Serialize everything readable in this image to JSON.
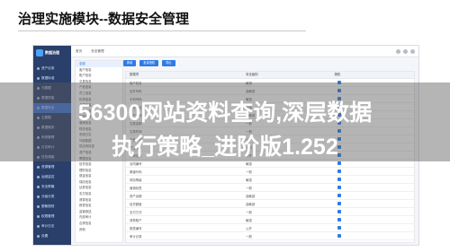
{
  "slide": {
    "title": "治理实施模块--数据安全管理"
  },
  "app": {
    "brand": "数据治理",
    "tabs": [
      "首页",
      "安全管理"
    ],
    "nav": [
      "资产目录",
      "数据标准",
      "元数据",
      "数据质量",
      "数据安全",
      "主数据",
      "数据服务",
      "系统管理",
      "日志审计",
      "任务调度",
      "资源管理",
      "运维监控",
      "安全策略",
      "分级分类",
      "脱敏规则",
      "权限管理",
      "审计日志",
      "设置"
    ],
    "toolbar": [
      "新增",
      "批量授权",
      "导出"
    ],
    "tree": [
      "全部",
      "客户信息",
      "账户信息",
      "交易信息",
      "产品信息",
      "员工信息",
      "机构信息",
      "合同信息",
      "渠道信息",
      "风险信息",
      "营销信息",
      "财务信息",
      "系统日志",
      "外部数据",
      "供应商信息",
      "资产信息",
      "票据信息",
      "信贷信息",
      "理财信息",
      "基金信息",
      "保险信息",
      "证券信息",
      "支付信息",
      "清算信息",
      "报表信息",
      "监管报送",
      "内部审计",
      "合规信息",
      "其他"
    ],
    "columns": [
      "数据项",
      "安全级别",
      "授权"
    ],
    "rows": [
      [
        "客户姓名",
        "敏感",
        "✓"
      ],
      [
        "证件号码",
        "高敏感",
        "✓"
      ],
      [
        "手机号码",
        "敏感",
        "✓"
      ],
      [
        "联系地址",
        "敏感",
        "✓"
      ],
      [
        "账户号码",
        "高敏感",
        "✓"
      ],
      [
        "交易金额",
        "一般",
        "✓"
      ],
      [
        "交易时间",
        "一般",
        "✓"
      ],
      [
        "产品名称",
        "公开",
        "✓"
      ],
      [
        "员工编号",
        "一般",
        "✓"
      ],
      [
        "机构名称",
        "公开",
        "✓"
      ],
      [
        "合同编号",
        "敏感",
        "✓"
      ],
      [
        "渠道代码",
        "一般",
        "✓"
      ],
      [
        "风险等级",
        "敏感",
        "✓"
      ],
      [
        "营销标签",
        "一般",
        "✓"
      ],
      [
        "资产余额",
        "高敏感",
        "✓"
      ],
      [
        "信贷额度",
        "高敏感",
        "✓"
      ],
      [
        "支付方式",
        "一般",
        "✓"
      ],
      [
        "清算账户",
        "敏感",
        "✓"
      ],
      [
        "报表编号",
        "公开",
        "✓"
      ],
      [
        "审计记录",
        "一般",
        "✓"
      ],
      [
        "其他字段",
        "公开",
        "✓"
      ]
    ]
  },
  "watermark": {
    "line1": "56300网站资料查询,深层数据",
    "line2": "执行策略_进阶版1.252"
  }
}
